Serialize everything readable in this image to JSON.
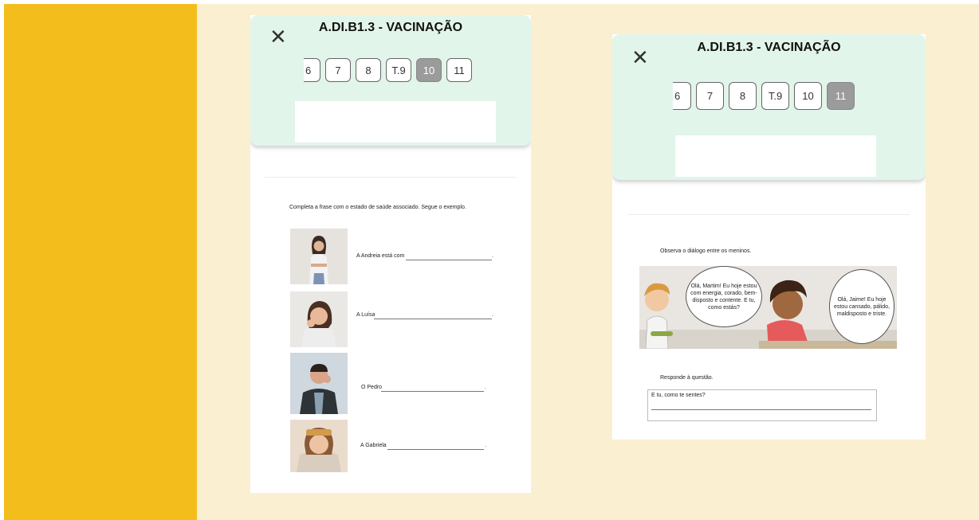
{
  "colors": {
    "sidebar": "#f3be1c",
    "background": "#fbefd2",
    "header": "#e2f5ea",
    "active_tab": "#9b9b9b"
  },
  "screen1": {
    "title": "A.DI.B1.3 - VACINAÇÃO",
    "close_icon": "close-icon",
    "tabs": [
      "6",
      "7",
      "8",
      "T.9",
      "10",
      "11"
    ],
    "active_tab": "10",
    "instruction": "Completa a frase com o estado de saúde associado. Segue o exemplo.",
    "rows": [
      {
        "text": "A Andreia está com",
        "end": "."
      },
      {
        "text": "A Luísa",
        "end": "."
      },
      {
        "text": "O Pedro",
        "end": "."
      },
      {
        "text": "A Gabriela",
        "end": "."
      }
    ]
  },
  "screen2": {
    "title": "A.DI.B1.3 - VACINAÇÃO",
    "close_icon": "close-icon",
    "tabs": [
      "6",
      "7",
      "8",
      "T.9",
      "10",
      "11"
    ],
    "active_tab": "11",
    "instruction": "Observa o diálogo entre os meninos.",
    "bubble_left": "Olá, Martim! Eu hoje estou com energia, corado, bem-disposto e contente. E tu, como estás?",
    "bubble_right": "Olá, Jaime! Eu hoje estou cansado, pálido, maldisposto e triste.",
    "question_instruction": "Responde à questão.",
    "question": "E tu, como te sentes?"
  }
}
